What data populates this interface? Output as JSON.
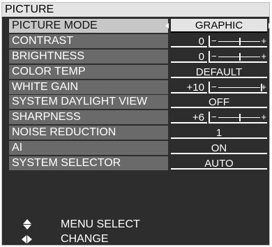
{
  "menu": {
    "title": "PICTURE",
    "items": [
      {
        "label": "PICTURE MODE",
        "type": "select",
        "value": "GRAPHIC",
        "selected": true
      },
      {
        "label": "CONTRAST",
        "type": "slider",
        "value": "0",
        "level": 0.5
      },
      {
        "label": "BRIGHTNESS",
        "type": "slider",
        "value": "0",
        "level": 0.5
      },
      {
        "label": "COLOR TEMP",
        "type": "select",
        "value": "DEFAULT"
      },
      {
        "label": "WHITE GAIN",
        "type": "slider",
        "value": "+10",
        "level": 1.0
      },
      {
        "label": "SYSTEM DAYLIGHT VIEW",
        "type": "select",
        "value": "OFF"
      },
      {
        "label": "SHARPNESS",
        "type": "slider",
        "value": "+6",
        "level": 0.5
      },
      {
        "label": "NOISE REDUCTION",
        "type": "select",
        "value": "1"
      },
      {
        "label": "AI",
        "type": "select",
        "value": "ON"
      },
      {
        "label": "SYSTEM SELECTOR",
        "type": "select",
        "value": "AUTO"
      }
    ]
  },
  "slider_symbols": {
    "minus": "−",
    "plus": "+"
  },
  "footer": {
    "menu_select": {
      "icon": "up-down-arrows-icon",
      "label": "MENU SELECT"
    },
    "change": {
      "icon": "left-right-arrows-icon",
      "label": "CHANGE"
    }
  },
  "colors": {
    "background": "#2d2d2d",
    "label_bg": "#6a6a6a",
    "selected_bg": "#c7c7c7",
    "header_bg": "#e4e4e4"
  }
}
